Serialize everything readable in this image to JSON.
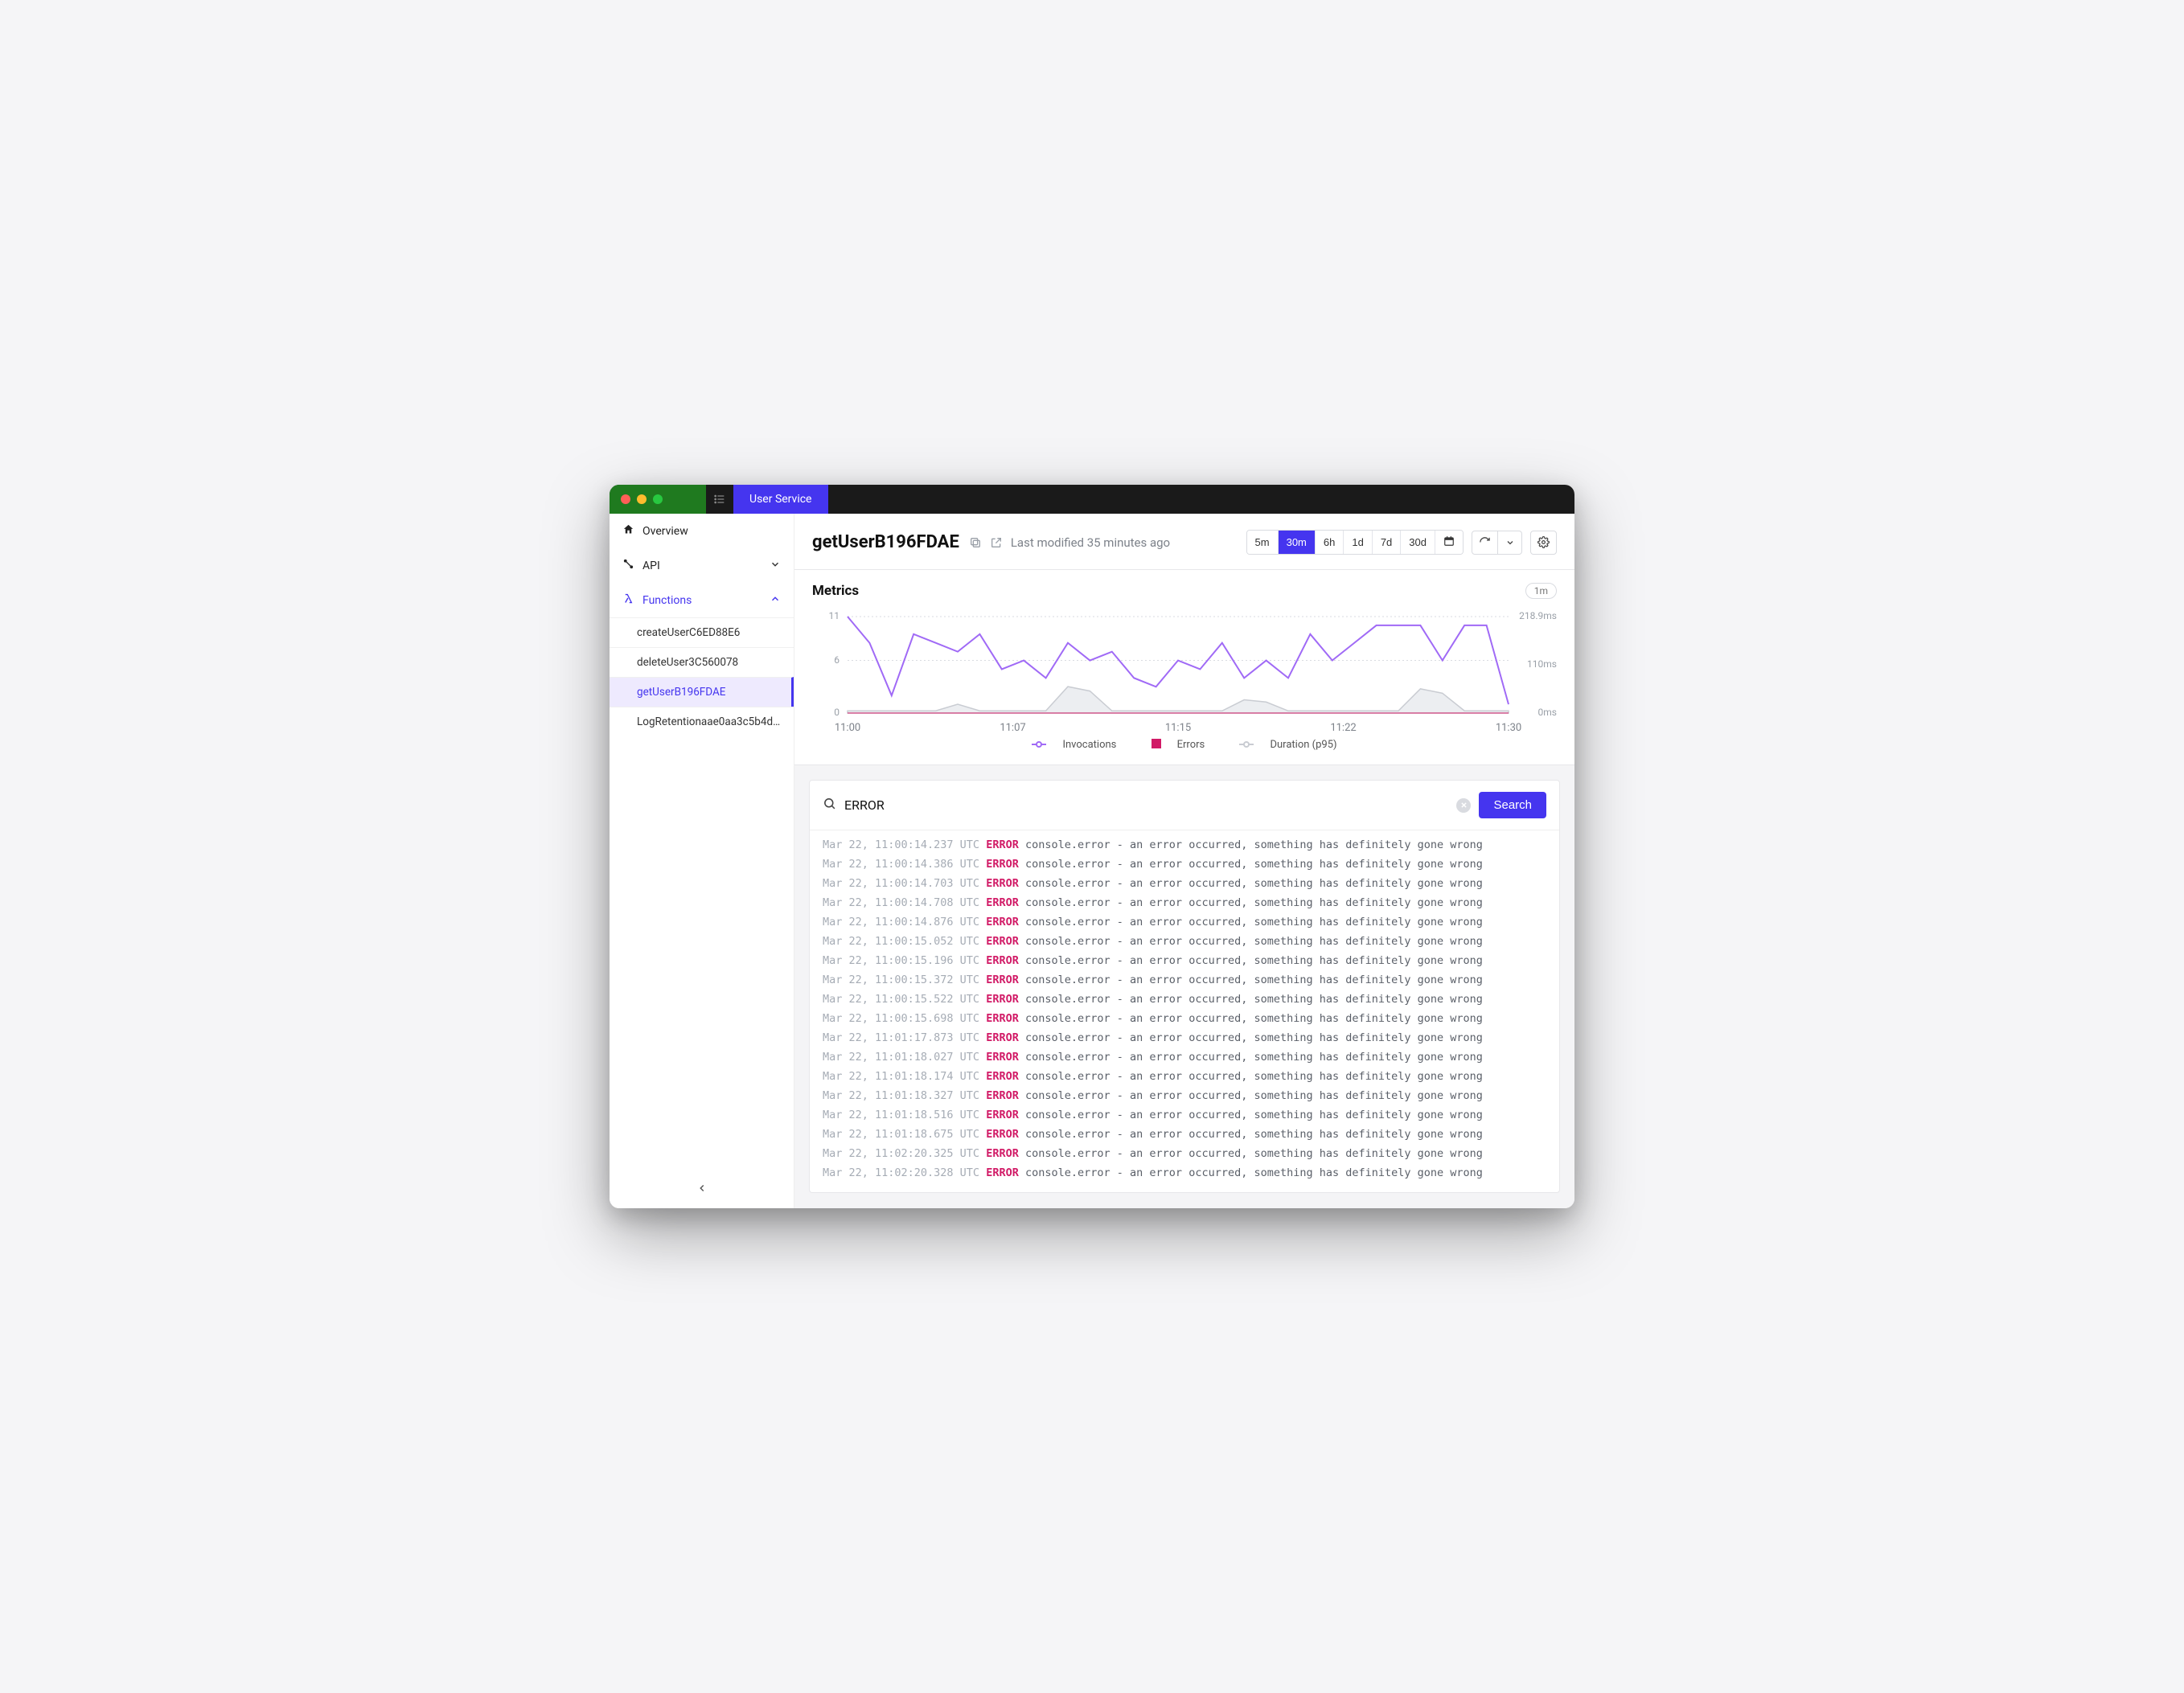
{
  "window": {
    "tab_label": "User Service"
  },
  "sidebar": {
    "overview": "Overview",
    "api": "API",
    "functions": "Functions",
    "items": [
      {
        "label": "createUserC6ED88E6"
      },
      {
        "label": "deleteUser3C560078"
      },
      {
        "label": "getUserB196FDAE"
      },
      {
        "label": "LogRetentionaae0aa3c5b4d4…"
      }
    ]
  },
  "header": {
    "title": "getUserB196FDAE",
    "last_modified": "Last modified 35 minutes ago",
    "ranges": [
      "5m",
      "30m",
      "6h",
      "1d",
      "7d",
      "30d"
    ],
    "active_range": "30m"
  },
  "metrics": {
    "title": "Metrics",
    "refresh_pill": "1m",
    "legend": {
      "inv": "Invocations",
      "err": "Errors",
      "dur": "Duration (p95)"
    }
  },
  "chart_data": {
    "type": "line",
    "x_labels": [
      "11:00",
      "11:07",
      "11:15",
      "11:22",
      "11:30"
    ],
    "y_left_ticks": [
      0,
      6,
      11
    ],
    "y_right_ticks": [
      "0ms",
      "110ms",
      "218.9ms"
    ],
    "ylim_left": [
      0,
      11
    ],
    "ylim_right_ms": [
      0,
      218.9
    ],
    "x_count": 31,
    "series": [
      {
        "name": "Invocations",
        "axis": "left",
        "color": "#a06af6",
        "values": [
          11,
          8,
          2,
          9,
          8,
          7,
          9,
          5,
          6,
          4,
          8,
          6,
          7,
          4,
          3,
          6,
          5,
          8,
          4,
          6,
          4,
          9,
          6,
          8,
          10,
          10,
          10,
          6,
          10,
          10,
          1
        ]
      },
      {
        "name": "Errors",
        "axis": "left",
        "color": "#d11a66",
        "values": [
          0,
          0,
          0,
          0,
          0,
          0,
          0,
          0,
          0,
          0,
          0,
          0,
          0,
          0,
          0,
          0,
          0,
          0,
          0,
          0,
          0,
          0,
          0,
          0,
          0,
          0,
          0,
          0,
          0,
          0,
          0
        ]
      },
      {
        "name": "Duration (p95)",
        "axis": "right_ms",
        "color": "#c9ccd2",
        "values": [
          5,
          5,
          5,
          5,
          5,
          20,
          5,
          5,
          5,
          5,
          60,
          50,
          5,
          5,
          5,
          5,
          5,
          5,
          30,
          25,
          5,
          5,
          5,
          5,
          5,
          5,
          55,
          45,
          5,
          5,
          5
        ]
      }
    ]
  },
  "logs": {
    "search_value": "ERROR",
    "search_button": "Search",
    "lines": [
      {
        "ts": "Mar 22, 11:00:14.237 UTC",
        "lvl": "ERROR",
        "msg": "console.error - an error occurred, something has definitely gone wrong"
      },
      {
        "ts": "Mar 22, 11:00:14.386 UTC",
        "lvl": "ERROR",
        "msg": "console.error - an error occurred, something has definitely gone wrong"
      },
      {
        "ts": "Mar 22, 11:00:14.703 UTC",
        "lvl": "ERROR",
        "msg": "console.error - an error occurred, something has definitely gone wrong"
      },
      {
        "ts": "Mar 22, 11:00:14.708 UTC",
        "lvl": "ERROR",
        "msg": "console.error - an error occurred, something has definitely gone wrong"
      },
      {
        "ts": "Mar 22, 11:00:14.876 UTC",
        "lvl": "ERROR",
        "msg": "console.error - an error occurred, something has definitely gone wrong"
      },
      {
        "ts": "Mar 22, 11:00:15.052 UTC",
        "lvl": "ERROR",
        "msg": "console.error - an error occurred, something has definitely gone wrong"
      },
      {
        "ts": "Mar 22, 11:00:15.196 UTC",
        "lvl": "ERROR",
        "msg": "console.error - an error occurred, something has definitely gone wrong"
      },
      {
        "ts": "Mar 22, 11:00:15.372 UTC",
        "lvl": "ERROR",
        "msg": "console.error - an error occurred, something has definitely gone wrong"
      },
      {
        "ts": "Mar 22, 11:00:15.522 UTC",
        "lvl": "ERROR",
        "msg": "console.error - an error occurred, something has definitely gone wrong"
      },
      {
        "ts": "Mar 22, 11:00:15.698 UTC",
        "lvl": "ERROR",
        "msg": "console.error - an error occurred, something has definitely gone wrong"
      },
      {
        "ts": "Mar 22, 11:01:17.873 UTC",
        "lvl": "ERROR",
        "msg": "console.error - an error occurred, something has definitely gone wrong"
      },
      {
        "ts": "Mar 22, 11:01:18.027 UTC",
        "lvl": "ERROR",
        "msg": "console.error - an error occurred, something has definitely gone wrong"
      },
      {
        "ts": "Mar 22, 11:01:18.174 UTC",
        "lvl": "ERROR",
        "msg": "console.error - an error occurred, something has definitely gone wrong"
      },
      {
        "ts": "Mar 22, 11:01:18.327 UTC",
        "lvl": "ERROR",
        "msg": "console.error - an error occurred, something has definitely gone wrong"
      },
      {
        "ts": "Mar 22, 11:01:18.516 UTC",
        "lvl": "ERROR",
        "msg": "console.error - an error occurred, something has definitely gone wrong"
      },
      {
        "ts": "Mar 22, 11:01:18.675 UTC",
        "lvl": "ERROR",
        "msg": "console.error - an error occurred, something has definitely gone wrong"
      },
      {
        "ts": "Mar 22, 11:02:20.325 UTC",
        "lvl": "ERROR",
        "msg": "console.error - an error occurred, something has definitely gone wrong"
      },
      {
        "ts": "Mar 22, 11:02:20.328 UTC",
        "lvl": "ERROR",
        "msg": "console.error - an error occurred, something has definitely gone wrong"
      }
    ]
  }
}
